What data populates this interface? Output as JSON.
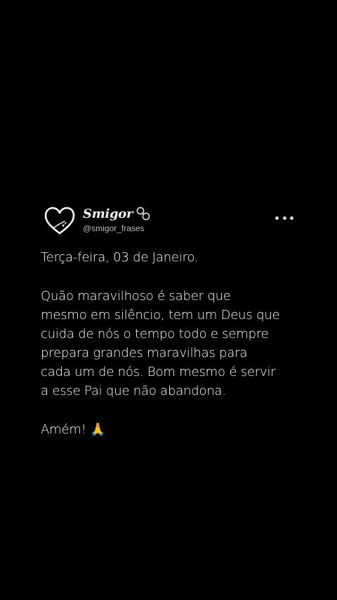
{
  "profile": {
    "display_name": "Smigor",
    "handle": "@smigor_frases",
    "avatar_icon": "heart-icon",
    "brand_icon": "linked-rings-icon"
  },
  "post": {
    "date_line": "Terça-feira, 03 de Janeiro.",
    "message_lines": [
      "Quão maravilhoso é saber que",
      "mesmo em silêncio, tem um Deus que",
      "cuida de nós o tempo todo e sempre",
      "prepara grandes maravilhas para",
      "cada um de nós. Bom mesmo é servir",
      "a esse Pai que não abandona."
    ],
    "closing": "Amém! 🙏"
  },
  "menu": {
    "icon": "more-horizontal-icon"
  },
  "colors": {
    "background": "#000000",
    "text": "#ffffff",
    "handle": "#b9b9b9"
  }
}
